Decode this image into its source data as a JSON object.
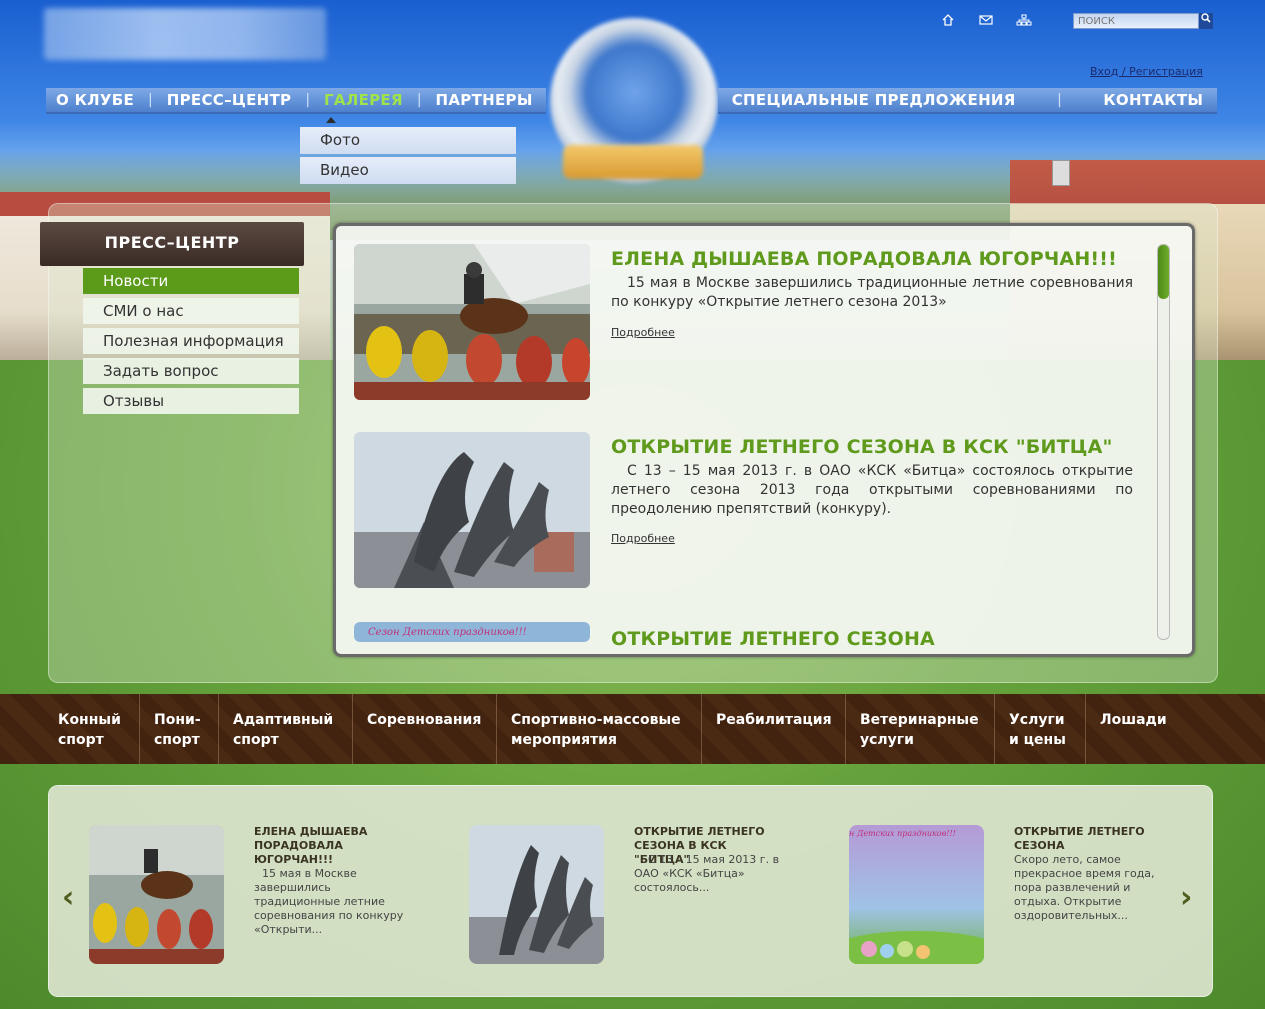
{
  "header": {
    "search_placeholder": "ПОИСК",
    "login_text": "Вход / Регистрация"
  },
  "nav": {
    "left": [
      "О КЛУБЕ",
      "ПРЕСС–ЦЕНТР",
      "ГАЛЕРЕЯ",
      "ПАРТНЕРЫ"
    ],
    "right": [
      "СПЕЦИАЛЬНЫЕ ПРЕДЛОЖЕНИЯ",
      "КОНТАКТЫ"
    ],
    "active": "ГАЛЕРЕЯ",
    "dropdown": [
      "Фото",
      "Видео"
    ]
  },
  "sidebar": {
    "title": "ПРЕСС–ЦЕНТР",
    "items": [
      "Новости",
      "СМИ о нас",
      "Полезная информация",
      "Задать вопрос",
      "Отзывы"
    ],
    "active": "Новости"
  },
  "news": [
    {
      "title": "ЕЛЕНА ДЫШАЕВА ПОРАДОВАЛА ЮГОРЧАН!!!",
      "text": "15 мая в Москве завершились традиционные летние соревнования по конкуру «Открытие летнего сезона 2013»",
      "more": "Подробнее"
    },
    {
      "title": "ОТКРЫТИЕ ЛЕТНЕГО СЕЗОНА В КСК \"БИТЦА\"",
      "text": "С 13 – 15 мая 2013 г. в ОАО «КСК «Битца» состоялось открытие летнего сезона 2013 года открытыми соревнованиями по преодолению препятствий (конкуру).",
      "more": "Подробнее"
    },
    {
      "title": "ОТКРЫТИЕ ЛЕТНЕГО СЕЗОНА",
      "image_caption": "Сезон Детских праздников!!!"
    }
  ],
  "services": [
    "Конный спорт",
    "Пони-спорт",
    "Адаптивный спорт",
    "Соревнования",
    "Спортивно-массовые мероприятия",
    "Реабилитация",
    "Ветеринарные услуги",
    "Услуги и цены",
    "Лошади"
  ],
  "carousel": [
    {
      "title": "ЕЛЕНА ДЫШАЕВА ПОРАДОВАЛА ЮГОРЧАН!!!",
      "text": "15 мая в Москве завершились традиционные летние соревнования по конкуру «Открыти..."
    },
    {
      "title": "ОТКРЫТИЕ ЛЕТНЕГО СЕЗОНА В КСК \"БИТЦА\"",
      "text": "С 13 – 15 мая 2013 г. в ОАО «КСК «Битца» состоялось..."
    },
    {
      "title": "ОТКРЫТИЕ ЛЕТНЕГО СЕЗОНА",
      "text": "Скоро лето, самое прекрасное время года, пора развлечений и отдыха. Открытие оздоровительных...",
      "image_caption": "н Детских праздников!!!"
    }
  ],
  "icons": [
    "home-icon",
    "mail-icon",
    "sitemap-icon",
    "search-icon",
    "arrow-left-icon",
    "arrow-right-icon"
  ]
}
